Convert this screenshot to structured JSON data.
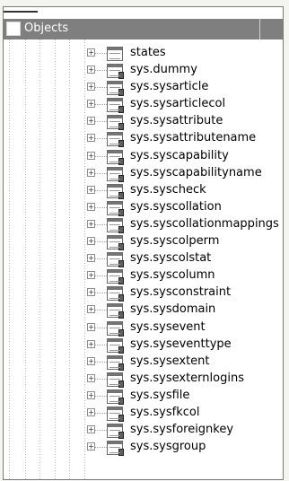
{
  "panel": {
    "title": "Objects"
  },
  "tree": {
    "items": [
      {
        "label": "states",
        "system": false
      },
      {
        "label": "sys.dummy",
        "system": true
      },
      {
        "label": "sys.sysarticle",
        "system": true
      },
      {
        "label": "sys.sysarticlecol",
        "system": true
      },
      {
        "label": "sys.sysattribute",
        "system": true
      },
      {
        "label": "sys.sysattributename",
        "system": true
      },
      {
        "label": "sys.syscapability",
        "system": true
      },
      {
        "label": "sys.syscapabilityname",
        "system": true
      },
      {
        "label": "sys.syscheck",
        "system": true
      },
      {
        "label": "sys.syscollation",
        "system": true
      },
      {
        "label": "sys.syscollationmappings",
        "system": true
      },
      {
        "label": "sys.syscolperm",
        "system": true
      },
      {
        "label": "sys.syscolstat",
        "system": true
      },
      {
        "label": "sys.syscolumn",
        "system": true
      },
      {
        "label": "sys.sysconstraint",
        "system": true
      },
      {
        "label": "sys.sysdomain",
        "system": true
      },
      {
        "label": "sys.sysevent",
        "system": true
      },
      {
        "label": "sys.syseventtype",
        "system": true
      },
      {
        "label": "sys.sysextent",
        "system": true
      },
      {
        "label": "sys.sysexternlogins",
        "system": true
      },
      {
        "label": "sys.sysfile",
        "system": true
      },
      {
        "label": "sys.sysfkcol",
        "system": true
      },
      {
        "label": "sys.sysforeignkey",
        "system": true
      },
      {
        "label": "sys.sysgroup",
        "system": true
      }
    ]
  }
}
